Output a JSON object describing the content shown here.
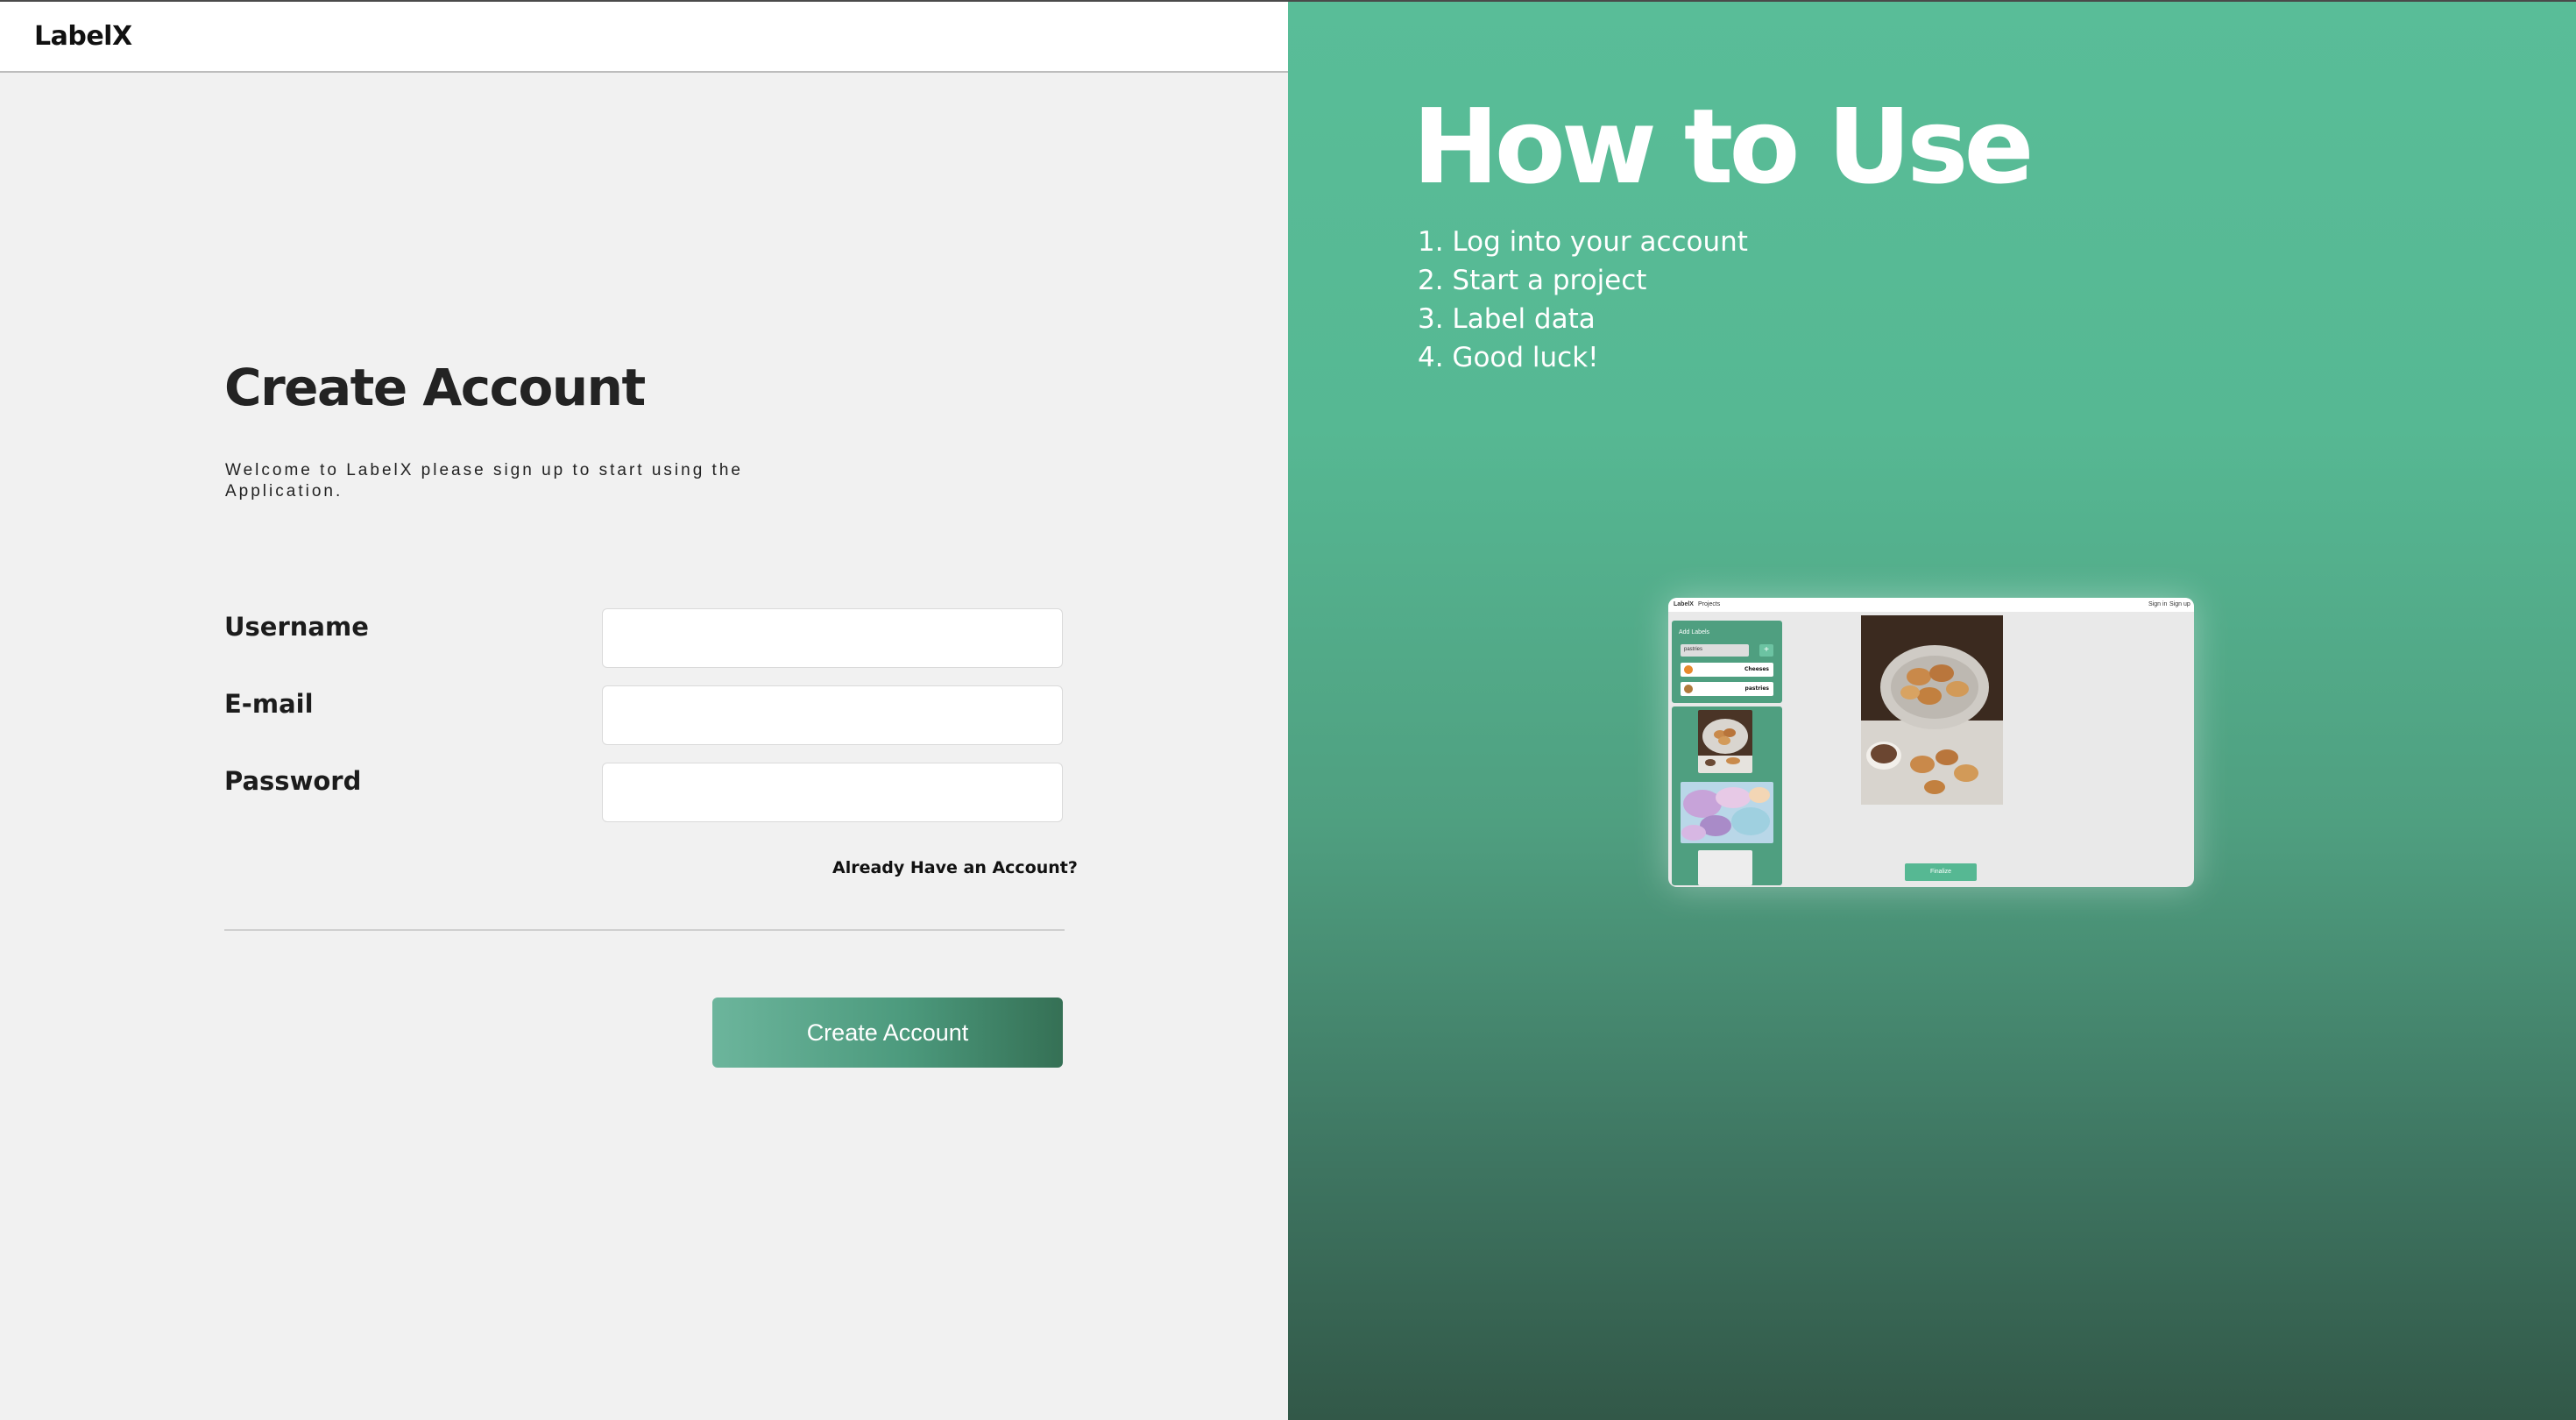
{
  "app": {
    "logo": "LabelX"
  },
  "signup": {
    "title": "Create Account",
    "subtitle": "Welcome to LabelX please sign up to start using the Application.",
    "fields": [
      {
        "label": "Username",
        "value": "",
        "placeholder": ""
      },
      {
        "label": "E-mail",
        "value": "",
        "placeholder": ""
      },
      {
        "label": "Password",
        "value": "",
        "placeholder": ""
      }
    ],
    "already_link": "Already Have an Account?",
    "submit_label": "Create Account"
  },
  "howto": {
    "title": "How to Use",
    "steps": [
      "1. Log into your account",
      "2. Start a project",
      "3. Label data",
      "4. Good luck!"
    ]
  },
  "preview": {
    "nav": {
      "logo": "LabelX",
      "projects": "Projects",
      "sign_in": "Sign in",
      "sign_up": "Sign up"
    },
    "panel_heading": "Add Labels",
    "input_value": "pastries",
    "labels": [
      {
        "text": "Cheeses",
        "color": "#e88a2d"
      },
      {
        "text": "pastries",
        "color": "#b07a3c"
      }
    ],
    "finalize_label": "Finalize"
  },
  "colors": {
    "accent": "#56b893",
    "accent_dark": "#325848",
    "button_start": "#6cb59c",
    "button_end": "#357055"
  }
}
